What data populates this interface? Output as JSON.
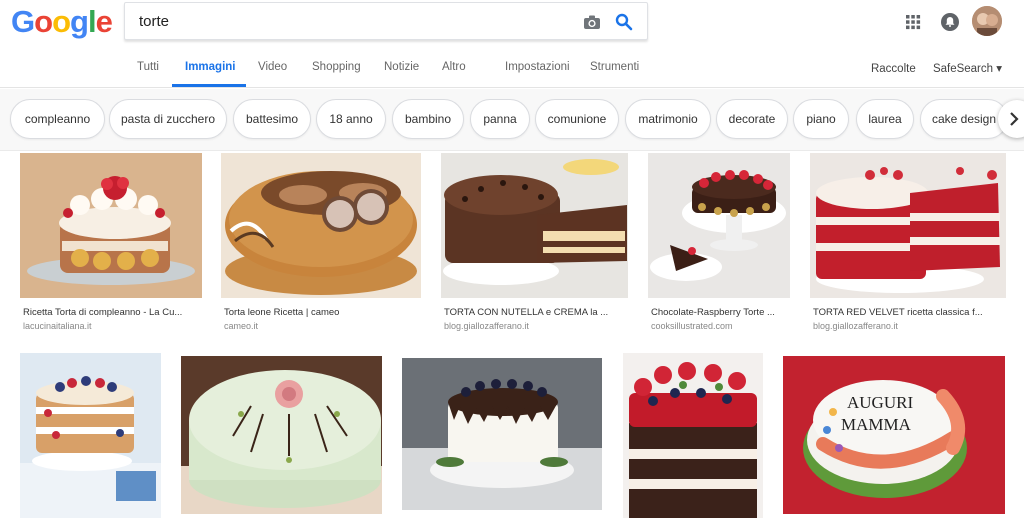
{
  "logo": {
    "letters": [
      "G",
      "o",
      "o",
      "g",
      "l",
      "e"
    ],
    "colors": [
      "#4285f4",
      "#ea4335",
      "#fbbc05",
      "#4285f4",
      "#34a853",
      "#ea4335"
    ]
  },
  "search": {
    "value": "torte"
  },
  "header_icons": {
    "camera": "camera-icon",
    "search": "magnifier-icon",
    "apps": "apps-grid-icon",
    "notifications": "bell-icon"
  },
  "tabs": [
    {
      "label": "Tutti"
    },
    {
      "label": "Immagini"
    },
    {
      "label": "Video"
    },
    {
      "label": "Shopping"
    },
    {
      "label": "Notizie"
    },
    {
      "label": "Altro"
    },
    {
      "label": "Impostazioni"
    },
    {
      "label": "Strumenti"
    }
  ],
  "active_tab": "Immagini",
  "right_links": {
    "collections": "Raccolte",
    "safesearch": "SafeSearch ▾"
  },
  "chips": [
    "compleanno",
    "pasta di zucchero",
    "battesimo",
    "18 anno",
    "bambino",
    "panna",
    "comunione",
    "matrimonio",
    "decorate",
    "piano",
    "laurea",
    "cake design"
  ],
  "results_row1": [
    {
      "title": "Ricetta Torta di compleanno - La Cu...",
      "source": "lacucinaitaliana.it"
    },
    {
      "title": "Torta leone Ricetta | cameo",
      "source": "cameo.it"
    },
    {
      "title": "TORTA CON NUTELLA e CREMA la ...",
      "source": "blog.giallozafferano.it"
    },
    {
      "title": "Chocolate-Raspberry Torte ...",
      "source": "cooksillustrated.com"
    },
    {
      "title": "TORTA RED VELVET ricetta classica f...",
      "source": "blog.giallozafferano.it"
    }
  ],
  "results_row2": [
    {
      "title": "",
      "source": ""
    },
    {
      "title": "",
      "source": ""
    },
    {
      "title": "",
      "source": ""
    },
    {
      "title": "",
      "source": ""
    },
    {
      "title": "",
      "source": ""
    }
  ],
  "cake_text": {
    "line1": "AUGURI",
    "line2": "MAMMA"
  },
  "colors": {
    "accent": "#1a73e8",
    "chip_border": "#dadce0"
  }
}
